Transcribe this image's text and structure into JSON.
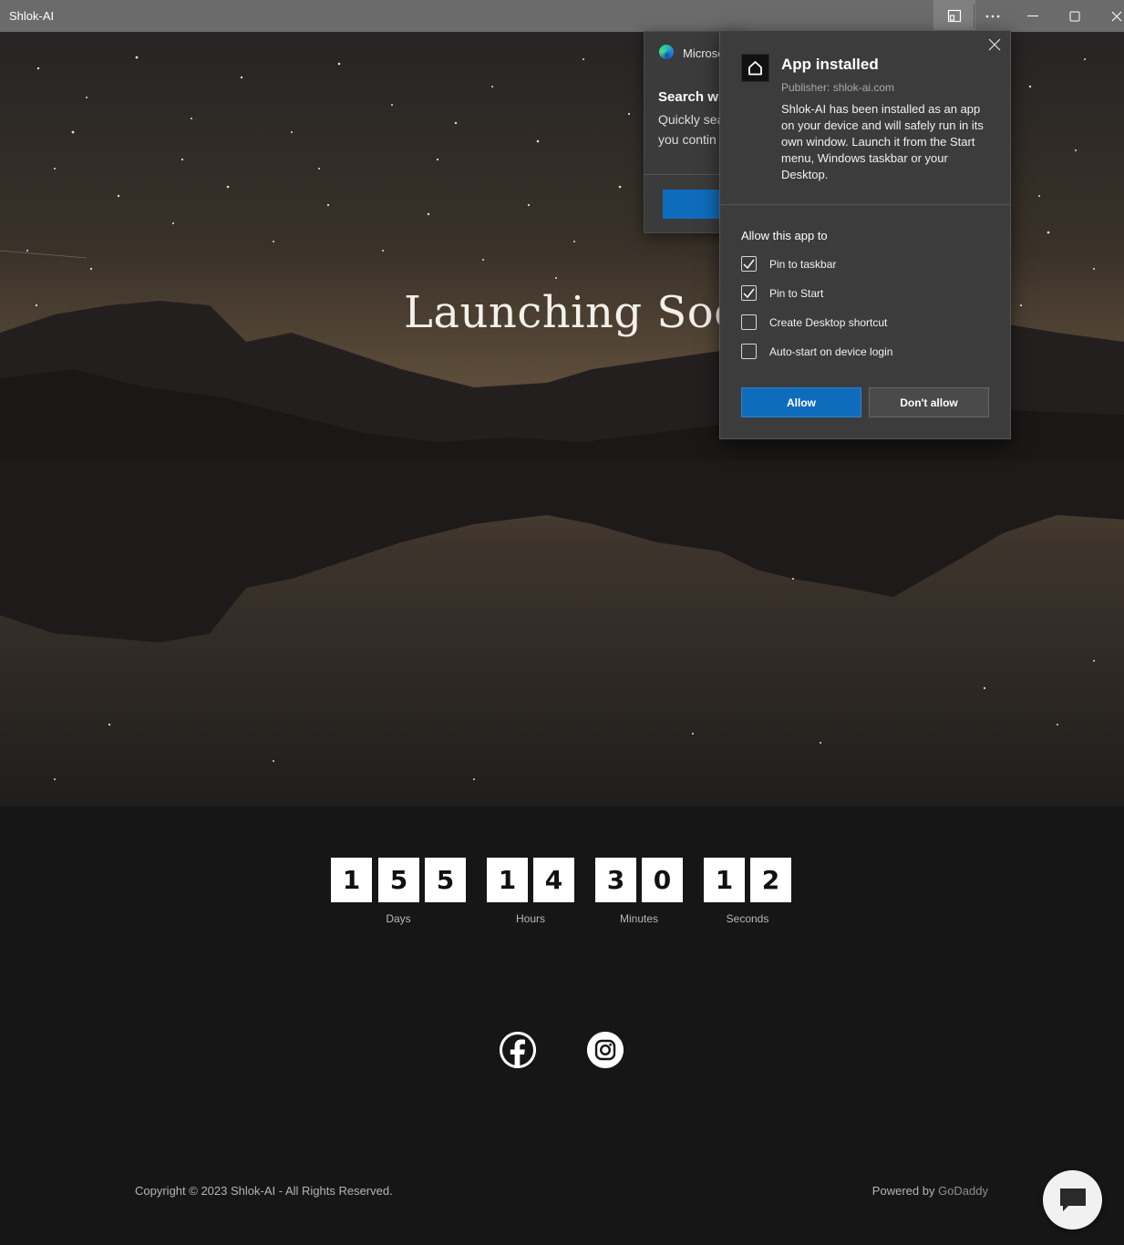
{
  "window": {
    "title": "Shlok-AI"
  },
  "hero": {
    "title": "Launching Soon"
  },
  "countdown": {
    "days": [
      "1",
      "5",
      "5"
    ],
    "hours": [
      "1",
      "4"
    ],
    "minutes": [
      "3",
      "0"
    ],
    "seconds": [
      "1",
      "2"
    ],
    "labels": {
      "days": "Days",
      "hours": "Hours",
      "minutes": "Minutes",
      "seconds": "Seconds"
    }
  },
  "social": {
    "icons": [
      "facebook-icon",
      "instagram-icon"
    ]
  },
  "footer": {
    "copyright": "Copyright © 2023 Shlok-AI - All Rights Reserved.",
    "powered_prefix": "Powered by",
    "powered_brand": "GoDaddy"
  },
  "edge_popup": {
    "brand": "Microsc",
    "heading": "Search wi",
    "line1": "Quickly sea",
    "line2": "you contin"
  },
  "install_dialog": {
    "title": "App installed",
    "publisher": "Publisher: shlok-ai.com",
    "description": "Shlok-AI has been installed as an app on your device and will safely run in its own window. Launch it from the Start menu, Windows taskbar or your Desktop.",
    "allow_heading": "Allow this app to",
    "options": [
      {
        "label": "Pin to taskbar",
        "checked": true
      },
      {
        "label": "Pin to Start",
        "checked": true
      },
      {
        "label": "Create Desktop shortcut",
        "checked": false
      },
      {
        "label": "Auto-start on device login",
        "checked": false
      }
    ],
    "allow_label": "Allow",
    "deny_label": "Don't allow"
  },
  "colors": {
    "accent": "#0f6cbd",
    "titlebar": "#6b6b6b",
    "page_bg": "#161616"
  }
}
